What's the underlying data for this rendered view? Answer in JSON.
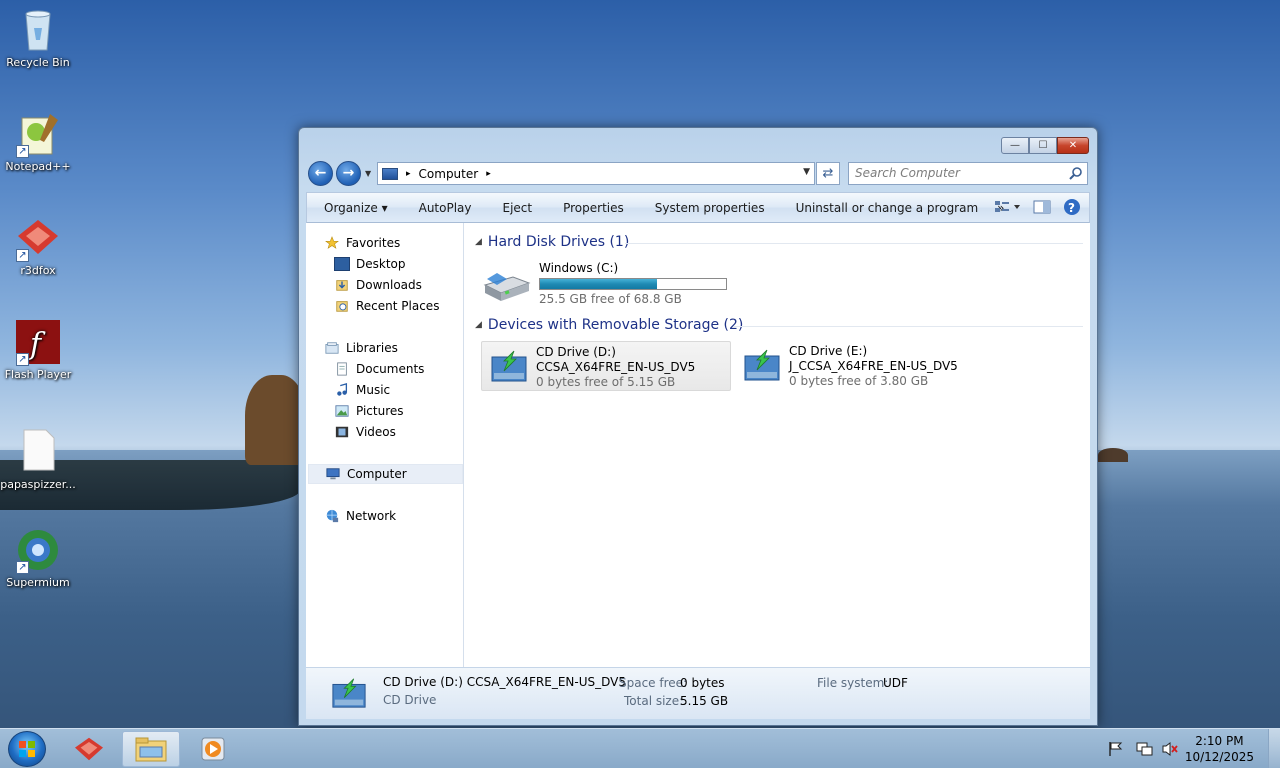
{
  "desktop": {
    "icons": [
      {
        "label": "Recycle Bin"
      },
      {
        "label": "Notepad++"
      },
      {
        "label": "r3dfox"
      },
      {
        "label": "Flash Player"
      },
      {
        "label": "papaspizzer..."
      },
      {
        "label": "Supermium"
      }
    ]
  },
  "window": {
    "controls": {
      "minimize": "—",
      "maximize": "☐",
      "close": "✕"
    },
    "address": {
      "path": "Computer",
      "separator": "▸"
    },
    "search": {
      "placeholder": "Search Computer"
    },
    "commands": [
      "Organize ▾",
      "AutoPlay",
      "Eject",
      "Properties",
      "System properties",
      "Uninstall or change a program",
      "»"
    ],
    "nav": {
      "favorites": {
        "label": "Favorites",
        "items": [
          "Desktop",
          "Downloads",
          "Recent Places"
        ]
      },
      "libraries": {
        "label": "Libraries",
        "items": [
          "Documents",
          "Music",
          "Pictures",
          "Videos"
        ]
      },
      "computer": "Computer",
      "network": "Network"
    },
    "groups": {
      "hdd": {
        "title": "Hard Disk Drives (1)"
      },
      "removable": {
        "title": "Devices with Removable Storage (2)"
      }
    },
    "drives": {
      "c": {
        "name": "Windows (C:)",
        "free": "25.5 GB free of 68.8 GB",
        "used_fraction": 0.63
      },
      "d": {
        "name": "CD Drive (D:)",
        "label": "CCSA_X64FRE_EN-US_DV5",
        "free": "0 bytes free of 5.15 GB"
      },
      "e": {
        "name": "CD Drive (E:)",
        "label": "J_CCSA_X64FRE_EN-US_DV5",
        "free": "0 bytes free of 3.80 GB"
      }
    },
    "details": {
      "title": "CD Drive (D:) CCSA_X64FRE_EN-US_DV5",
      "type": "CD Drive",
      "space_free_label": "Space free:",
      "space_free": "0 bytes",
      "total_size_label": "Total size:",
      "total_size": "5.15 GB",
      "fs_label": "File system:",
      "fs": "UDF"
    }
  },
  "taskbar": {
    "time": "2:10 PM",
    "date": "10/12/2025"
  },
  "colors": {
    "group_header": "#1e3287",
    "progress": "#1f8ab3"
  }
}
